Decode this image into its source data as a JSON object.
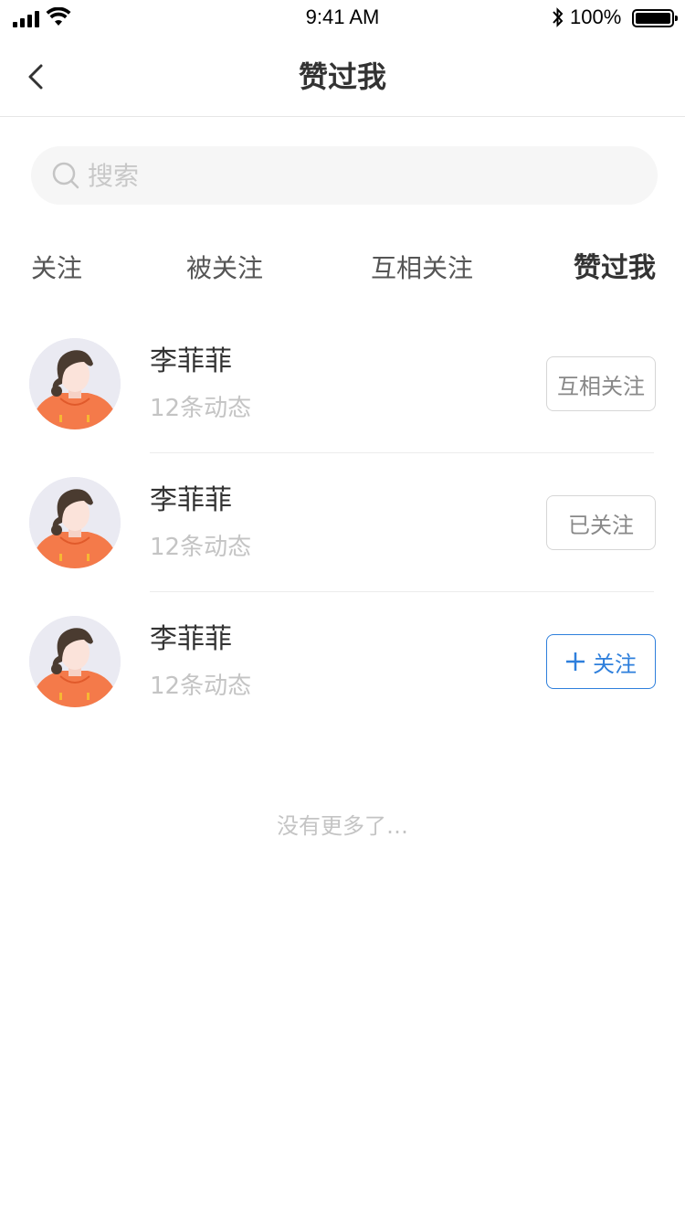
{
  "status_bar": {
    "time": "9:41 AM",
    "battery_percent": "100%",
    "icons": [
      "signal-icon",
      "wifi-icon",
      "bluetooth-icon",
      "battery-icon"
    ]
  },
  "nav": {
    "title": "赞过我",
    "back_icon": "chevron-left-icon"
  },
  "search": {
    "placeholder": "搜索",
    "value": "",
    "icon": "search-icon"
  },
  "tabs": [
    {
      "label": "关注",
      "active": false
    },
    {
      "label": "被关注",
      "active": false
    },
    {
      "label": "互相关注",
      "active": false
    },
    {
      "label": "赞过我",
      "active": true
    }
  ],
  "users": [
    {
      "name": "李菲菲",
      "subtitle": "12条动态",
      "action": "互相关注",
      "action_style": "outline"
    },
    {
      "name": "李菲菲",
      "subtitle": "12条动态",
      "action": "已关注",
      "action_style": "outline"
    },
    {
      "name": "李菲菲",
      "subtitle": "12条动态",
      "action": "关注",
      "action_style": "primary",
      "action_icon": "plus-icon"
    }
  ],
  "footer": {
    "no_more": "没有更多了…"
  },
  "colors": {
    "accent": "#2e7fdc",
    "avatar_shirt": "#f47a4a",
    "avatar_bg": "#eaeaf2",
    "hair": "#4a3b30"
  }
}
